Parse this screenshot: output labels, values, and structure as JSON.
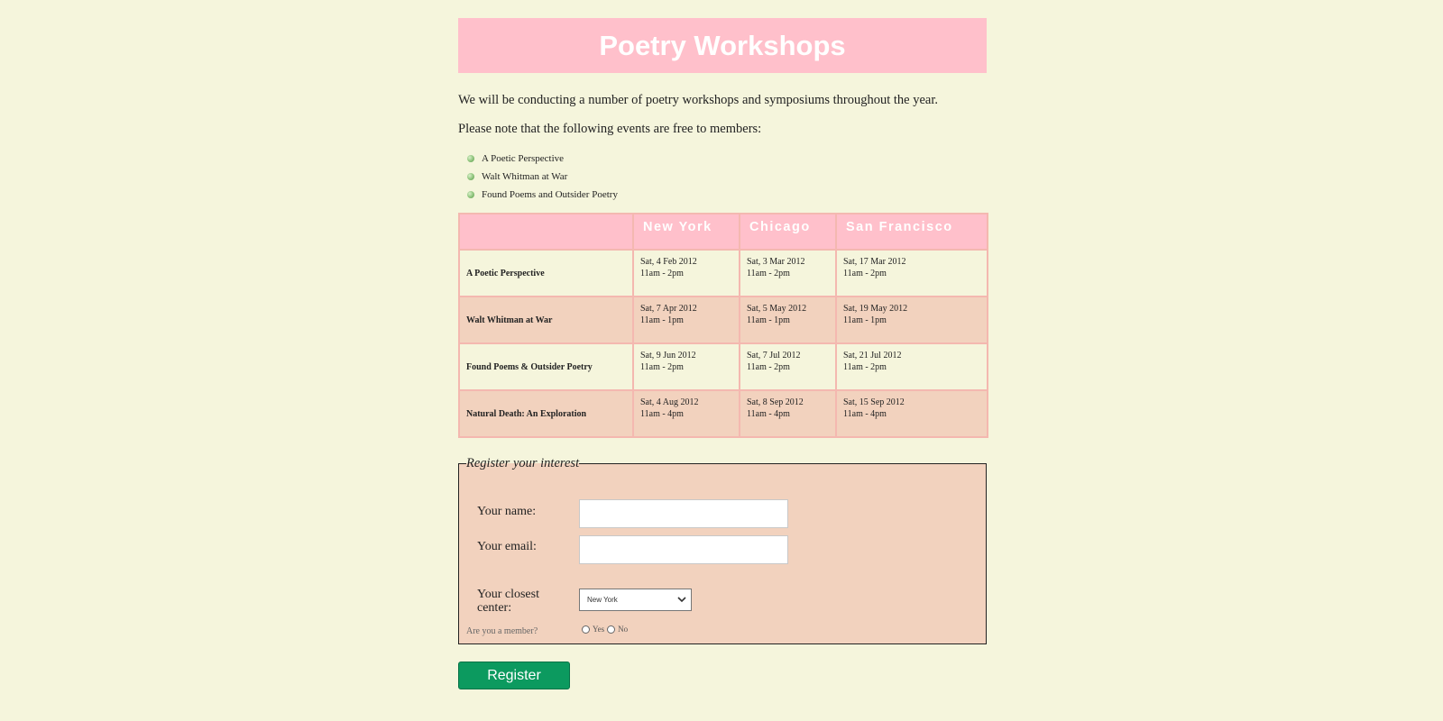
{
  "header": {
    "title": "Poetry Workshops"
  },
  "intro": {
    "paragraph1": "We will be conducting a number of poetry workshops and symposiums throughout the year.",
    "paragraph2": "Please note that the following events are free to members:"
  },
  "free_events": [
    "A Poetic Perspective",
    "Walt Whitman at War",
    "Found Poems and Outsider Poetry"
  ],
  "schedule": {
    "columns": [
      "",
      "New York",
      "Chicago",
      "San Francisco"
    ],
    "rows": [
      {
        "event": "A Poetic Perspective",
        "cells": [
          {
            "date": "Sat, 4 Feb 2012",
            "time": "11am - 2pm"
          },
          {
            "date": "Sat, 3 Mar 2012",
            "time": "11am - 2pm"
          },
          {
            "date": "Sat, 17 Mar 2012",
            "time": "11am - 2pm"
          }
        ]
      },
      {
        "event": "Walt Whitman at War",
        "cells": [
          {
            "date": "Sat, 7 Apr 2012",
            "time": "11am - 1pm"
          },
          {
            "date": "Sat, 5 May 2012",
            "time": "11am - 1pm"
          },
          {
            "date": "Sat, 19 May 2012",
            "time": "11am - 1pm"
          }
        ]
      },
      {
        "event": "Found Poems & Outsider Poetry",
        "cells": [
          {
            "date": "Sat, 9 Jun 2012",
            "time": "11am - 2pm"
          },
          {
            "date": "Sat, 7 Jul 2012",
            "time": "11am - 2pm"
          },
          {
            "date": "Sat, 21 Jul 2012",
            "time": "11am - 2pm"
          }
        ]
      },
      {
        "event": "Natural Death: An Exploration",
        "cells": [
          {
            "date": "Sat, 4 Aug 2012",
            "time": "11am - 4pm"
          },
          {
            "date": "Sat, 8 Sep 2012",
            "time": "11am - 4pm"
          },
          {
            "date": "Sat, 15 Sep 2012",
            "time": "11am - 4pm"
          }
        ]
      }
    ]
  },
  "form": {
    "legend": "Register your interest",
    "name_label": "Your name:",
    "name_value": "",
    "email_label": "Your email:",
    "email_value": "",
    "center_label": "Your closest center:",
    "center_selected": "New York",
    "member_label": "Are you a member?",
    "member_options": [
      "Yes",
      "No"
    ],
    "submit_label": "Register"
  },
  "colors": {
    "background": "#f5f5dc",
    "banner": "#ffc0cb",
    "row_alt": "#f2d2be",
    "button": "#0c9a5f"
  },
  "icons": {
    "bullet": "green-bullet-icon",
    "select": "chevron-down-icon"
  }
}
